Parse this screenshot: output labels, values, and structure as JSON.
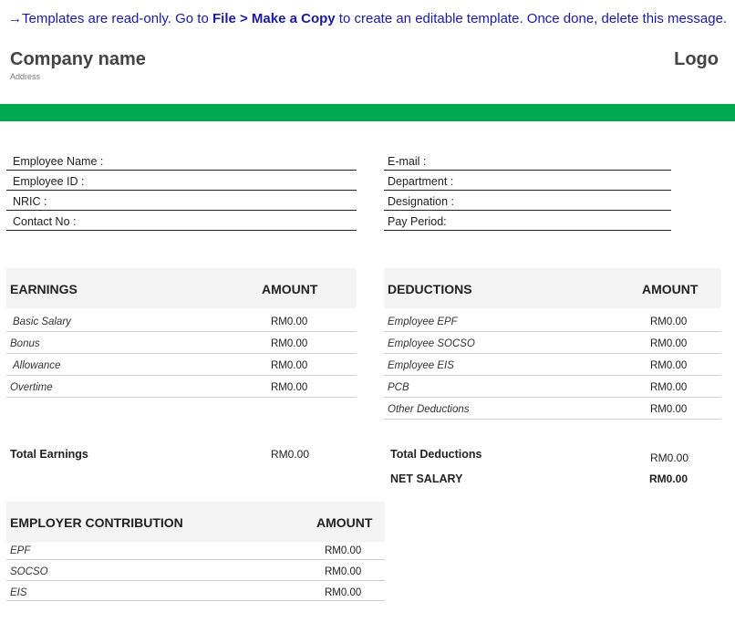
{
  "notice": {
    "prefix": "→Templates are read-only. Go to ",
    "emphasis": "File > Make a Copy",
    "suffix": " to create an editable template. Once done, delete this message."
  },
  "header": {
    "company_name": "Company name",
    "address": "Address",
    "logo": "Logo"
  },
  "colors": {
    "accent_bar": "#00a94f"
  },
  "employee_fields_left": [
    "Employee Name :",
    "Employee ID :",
    "NRIC :",
    "Contact No :"
  ],
  "employee_fields_right": [
    "E-mail :",
    "Department :",
    "Designation :",
    "Pay Period:"
  ],
  "earnings": {
    "title": "EARNINGS",
    "amount_label": "AMOUNT",
    "items": [
      {
        "label": "Basic Salary",
        "value": "RM0.00"
      },
      {
        "label": "Bonus",
        "value": "RM0.00"
      },
      {
        "label": "Allowance",
        "value": "RM0.00"
      },
      {
        "label": "Overtime",
        "value": "RM0.00"
      }
    ],
    "total_label": "Total Earnings",
    "total_value": "RM0.00"
  },
  "deductions": {
    "title": "DEDUCTIONS",
    "amount_label": "AMOUNT",
    "items": [
      {
        "label": "Employee EPF",
        "value": "RM0.00"
      },
      {
        "label": "Employee SOCSO",
        "value": "RM0.00"
      },
      {
        "label": "Employee EIS",
        "value": "RM0.00"
      },
      {
        "label": "PCB",
        "value": "RM0.00"
      },
      {
        "label": "Other Deductions",
        "value": "RM0.00"
      }
    ],
    "total_label": "Total Deductions",
    "total_value": "RM0.00",
    "net_label": "NET SALARY",
    "net_value": "RM0.00"
  },
  "employer": {
    "title": "EMPLOYER CONTRIBUTION",
    "amount_label": "AMOUNT",
    "items": [
      {
        "label": "EPF",
        "value": "RM0.00"
      },
      {
        "label": "SOCSO",
        "value": "RM0.00"
      },
      {
        "label": "EIS",
        "value": "RM0.00"
      }
    ]
  }
}
